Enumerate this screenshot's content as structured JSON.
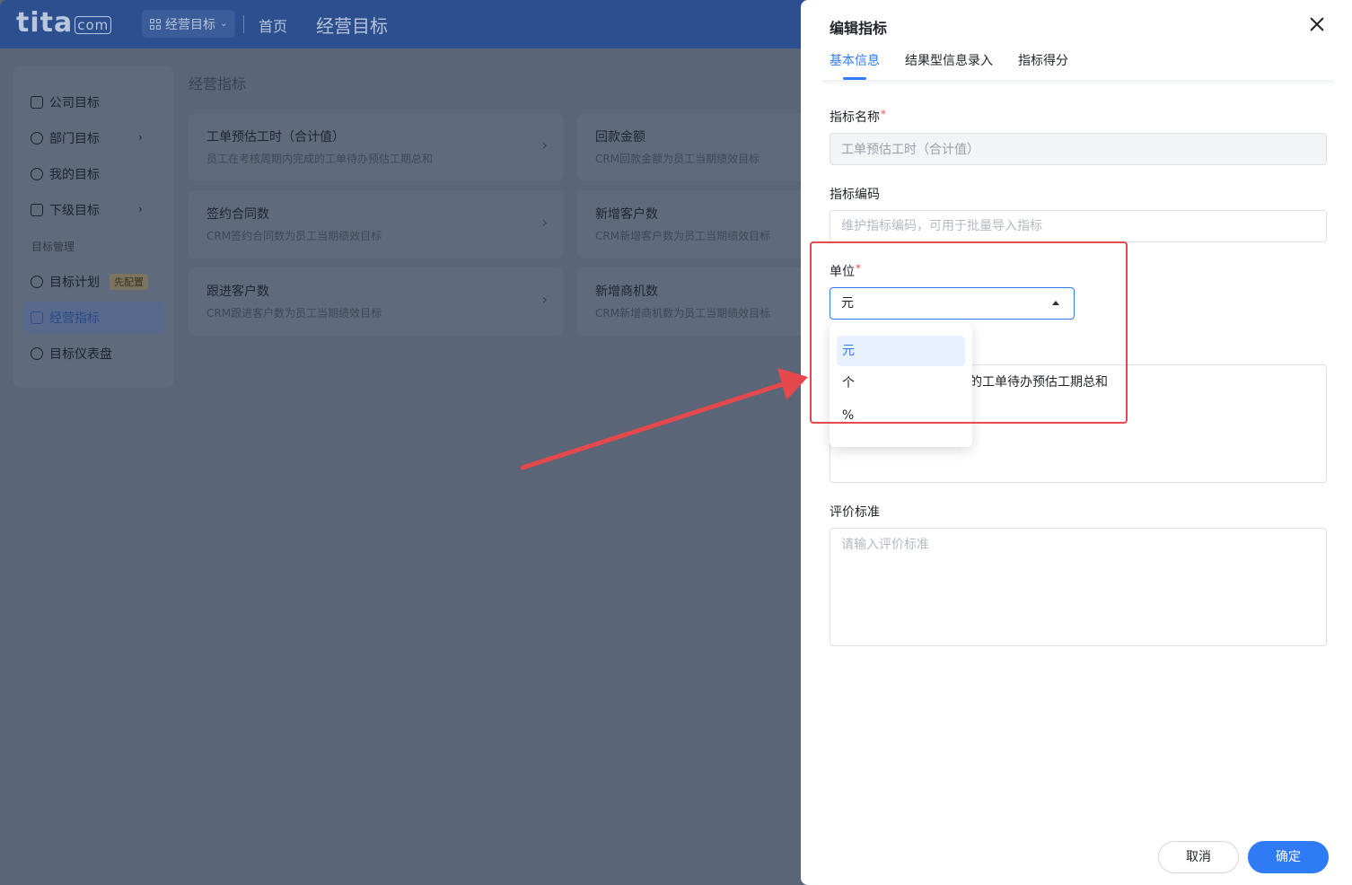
{
  "app": {
    "logo_text": "tita",
    "logo_suffix": "com",
    "switcher_label": "经营目标",
    "nav_home": "首页",
    "nav_current": "经营目标"
  },
  "sidebar": {
    "items": [
      {
        "label": "公司目标"
      },
      {
        "label": "部门目标"
      },
      {
        "label": "我的目标"
      },
      {
        "label": "下级目标"
      }
    ],
    "group_label": "目标管理",
    "management_items": [
      {
        "label": "目标计划",
        "tag": "先配置"
      },
      {
        "label": "经营指标"
      },
      {
        "label": "目标仪表盘"
      }
    ]
  },
  "main": {
    "title": "经营指标",
    "cards": [
      {
        "title": "工单预估工时（合计值）",
        "desc": "员工在考核周期内完成的工单待办预估工期总和"
      },
      {
        "title": "回款金额",
        "desc": "CRM回款金额为员工当期绩效目标"
      },
      {
        "title": "签约合同数",
        "desc": "CRM签约合同数为员工当期绩效目标"
      },
      {
        "title": "新增客户数",
        "desc": "CRM新增客户数为员工当期绩效目标"
      },
      {
        "title": "跟进客户数",
        "desc": "CRM跟进客户数为员工当期绩效目标"
      },
      {
        "title": "新增商机数",
        "desc": "CRM新增商机数为员工当期绩效目标"
      }
    ]
  },
  "drawer": {
    "title": "编辑指标",
    "tabs": [
      {
        "label": "基本信息",
        "active": true
      },
      {
        "label": "结果型信息录入",
        "active": false
      },
      {
        "label": "指标得分",
        "active": false
      }
    ],
    "fields": {
      "name_label": "指标名称",
      "name_value": "工单预估工时（合计值）",
      "code_label": "指标编码",
      "code_placeholder": "维护指标编码，可用于批量导入指标",
      "unit_label": "单位",
      "unit_value": "元",
      "unit_options": [
        "元",
        "个",
        "%"
      ],
      "desc_visible_text": "的工单待办预估工期总和",
      "criteria_label": "评价标准",
      "criteria_placeholder": "请输入评价标准"
    },
    "buttons": {
      "cancel": "取消",
      "confirm": "确定"
    }
  },
  "colors": {
    "accent": "#2f7bf5",
    "annotation": "#e5484d",
    "overlay": "#5a6577"
  }
}
